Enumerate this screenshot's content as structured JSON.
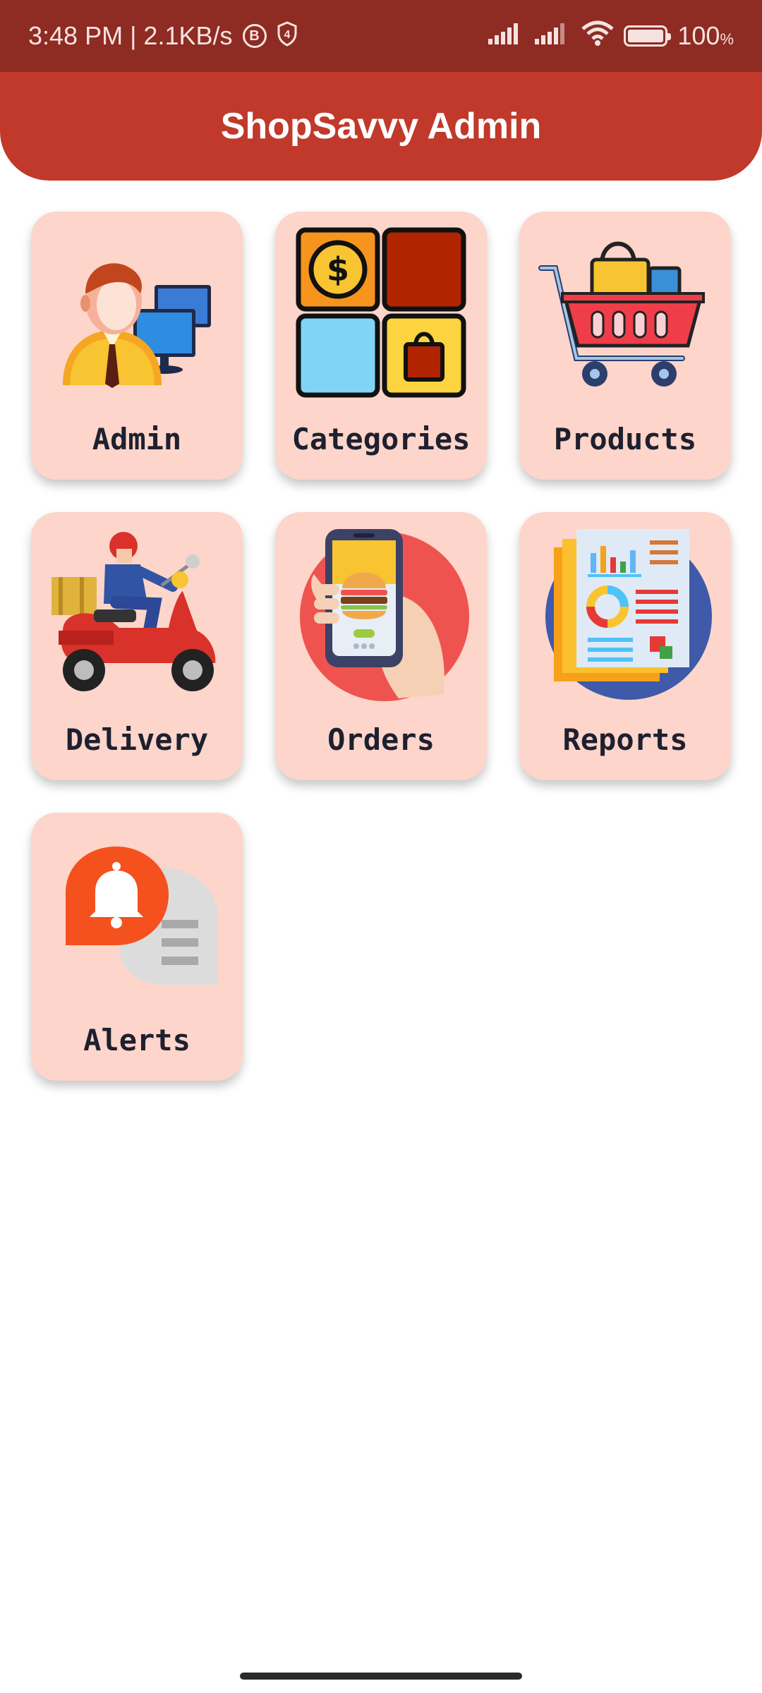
{
  "status_bar": {
    "time": "3:48 PM | 2.1KB/s",
    "badge_b": "B",
    "badge_shield": "4",
    "battery_text": "100",
    "battery_unit": "%"
  },
  "app_bar": {
    "title": "ShopSavvy Admin",
    "color": "#c0392b"
  },
  "tiles": [
    {
      "label": "Admin",
      "icon": "admin-icon"
    },
    {
      "label": "Categories",
      "icon": "categories-icon"
    },
    {
      "label": "Products",
      "icon": "shopping-cart-icon"
    },
    {
      "label": "Delivery",
      "icon": "delivery-scooter-icon"
    },
    {
      "label": "Orders",
      "icon": "phone-order-icon"
    },
    {
      "label": "Reports",
      "icon": "report-icon"
    },
    {
      "label": "Alerts",
      "icon": "notification-bell-icon"
    }
  ],
  "colors": {
    "status_bar": "#8e2b22",
    "tile_background": "#fdd5ca",
    "tile_text": "#1e2030"
  }
}
